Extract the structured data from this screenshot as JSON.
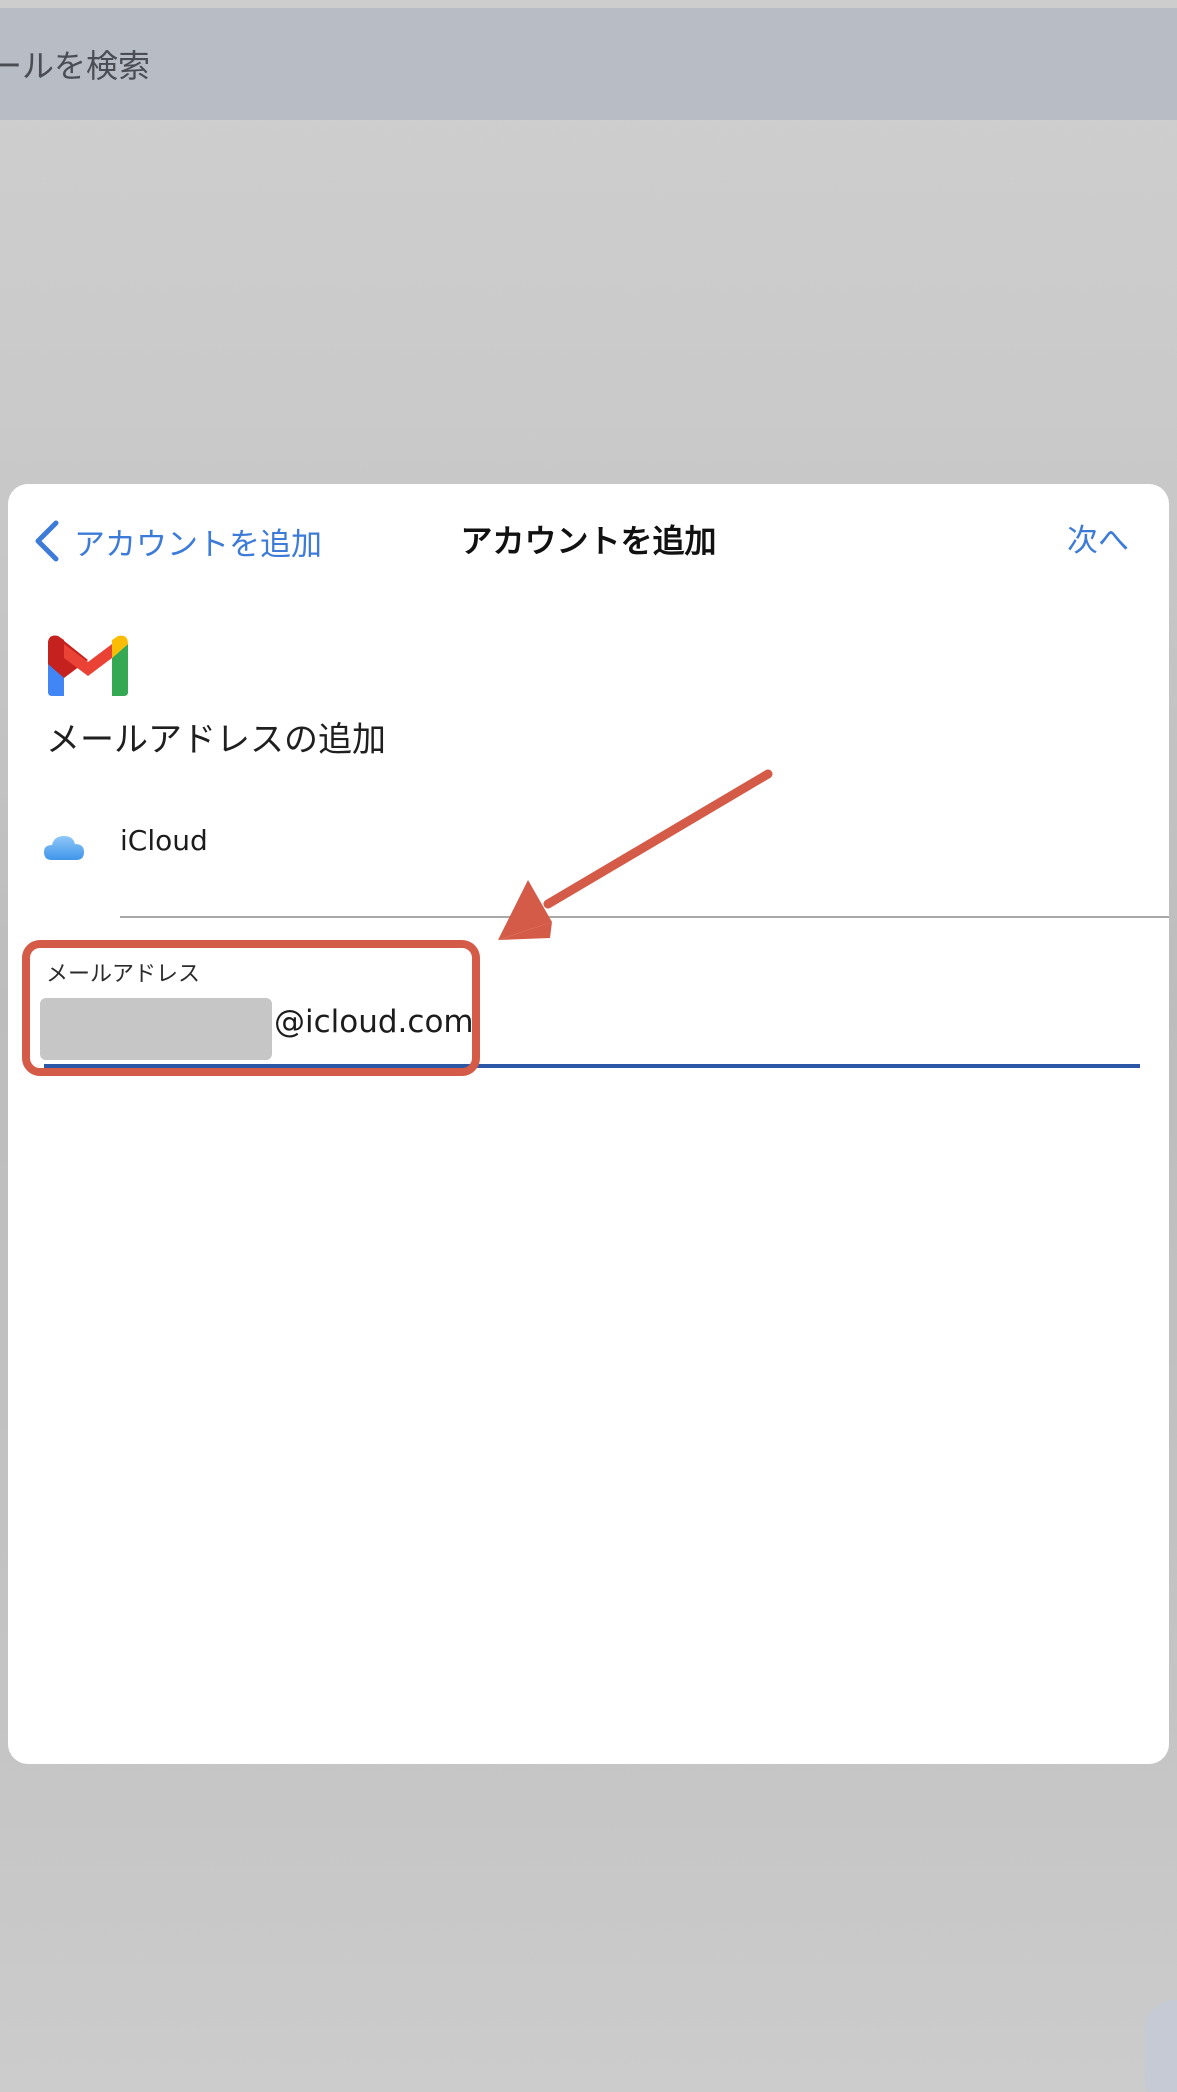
{
  "search": {
    "text": "ールを検索"
  },
  "sheet": {
    "back_label": "アカウントを追加",
    "title": "アカウントを追加",
    "next_label": "次へ",
    "heading": "メールアドレスの追加",
    "provider": {
      "label": "iCloud",
      "icon": "icloud-icon"
    },
    "email": {
      "label": "メールアドレス",
      "suffix": "@icloud.com"
    }
  },
  "colors": {
    "accent": "#3d7bd8",
    "annotation": "#d45b47",
    "field_underline": "#2c56a6"
  }
}
